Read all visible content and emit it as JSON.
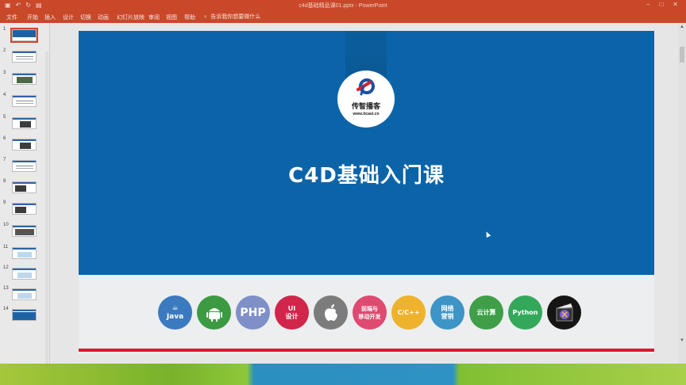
{
  "app": {
    "window_title": "c4d基础精品课01.pptx  -  PowerPoint",
    "qat_icons": [
      "save-icon",
      "undo-icon",
      "redo-icon",
      "presenter-icon"
    ]
  },
  "ribbon": {
    "tabs": [
      "文件",
      "开始",
      "插入",
      "设计",
      "切换",
      "动画",
      "幻灯片放映",
      "审阅",
      "视图",
      "帮助"
    ],
    "tell_me_placeholder": "告诉我你想要做什么"
  },
  "thumbnails": {
    "numbers": [
      "1",
      "2",
      "3",
      "4",
      "5",
      "6",
      "7",
      "8",
      "9",
      "10",
      "11",
      "12",
      "13",
      "14"
    ],
    "selected": "1"
  },
  "slide": {
    "logo_name": "传智播客",
    "logo_url": "www.itcast.cn",
    "title": "C4D基础入门课",
    "courses": [
      {
        "label": "Java",
        "color": "#3b7abf"
      },
      {
        "label": "",
        "color": "#3c9a42"
      },
      {
        "label": "PHP",
        "color": "#7f8fc8"
      },
      {
        "label": "UI\n设计",
        "color": "#d2254b"
      },
      {
        "label": "",
        "color": "#7c7c7c"
      },
      {
        "label": "前端与\n移动开发",
        "color": "#df4a70"
      },
      {
        "label": "C/C++",
        "color": "#eeb22c"
      },
      {
        "label": "网络\n营销",
        "color": "#3d94c6"
      },
      {
        "label": "云计算",
        "color": "#3f9f48"
      },
      {
        "label": "Python",
        "color": "#34a85a"
      },
      {
        "label": "",
        "color": "#151515"
      }
    ]
  },
  "colors": {
    "accent": "#c9482a",
    "slide_blue": "#0b64a8",
    "red_line": "#d8192c"
  }
}
